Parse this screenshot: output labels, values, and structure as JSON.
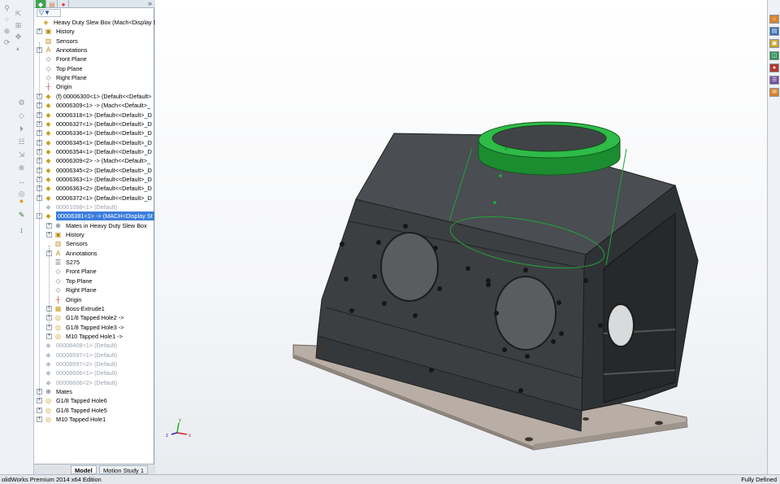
{
  "feature_manager": {
    "collapse_glyph": "»",
    "filter_glyph": "▼",
    "tabs": [
      {
        "icon": "feature-tree-icon"
      },
      {
        "icon": "property-manager-icon"
      },
      {
        "icon": "configuration-manager-icon"
      }
    ],
    "tree": [
      {
        "label": "Heavy Duty Slew Box  (Mach<Display St",
        "icon": "assembly-icon",
        "level": 0,
        "expander": "",
        "suppressed": false
      },
      {
        "label": "History",
        "icon": "history-icon",
        "level": 1,
        "expander": "+",
        "suppressed": false
      },
      {
        "label": "Sensors",
        "icon": "sensors-icon",
        "level": 1,
        "expander": "",
        "suppressed": false
      },
      {
        "label": "Annotations",
        "icon": "annotations-icon",
        "level": 1,
        "expander": "+",
        "suppressed": false
      },
      {
        "label": "Front Plane",
        "icon": "plane-icon",
        "level": 1,
        "expander": "",
        "suppressed": false
      },
      {
        "label": "Top Plane",
        "icon": "plane-icon",
        "level": 1,
        "expander": "",
        "suppressed": false
      },
      {
        "label": "Right Plane",
        "icon": "plane-icon",
        "level": 1,
        "expander": "",
        "suppressed": false
      },
      {
        "label": "Origin",
        "icon": "origin-icon",
        "level": 1,
        "expander": "",
        "suppressed": false
      },
      {
        "label": "(f) 00006300<1> (Default<<Default>",
        "icon": "part-icon",
        "level": 1,
        "expander": "+",
        "suppressed": false
      },
      {
        "label": "00006309<1> -> (Mach<<Default>_",
        "icon": "part-icon",
        "level": 1,
        "expander": "+",
        "suppressed": false
      },
      {
        "label": "00006318<1> (Default<<Default>_D",
        "icon": "part-icon",
        "level": 1,
        "expander": "+",
        "suppressed": false
      },
      {
        "label": "00006327<1> (Default<<Default>_D",
        "icon": "part-icon",
        "level": 1,
        "expander": "+",
        "suppressed": false
      },
      {
        "label": "00006336<1> (Default<<Default>_D",
        "icon": "part-icon",
        "level": 1,
        "expander": "+",
        "suppressed": false
      },
      {
        "label": "00006345<1> (Default<<Default>_D",
        "icon": "part-icon",
        "level": 1,
        "expander": "+",
        "suppressed": false
      },
      {
        "label": "00006354<1> (Default<<Default>_D",
        "icon": "part-icon",
        "level": 1,
        "expander": "+",
        "suppressed": false
      },
      {
        "label": "00006309<2> -> (Mach<<Default>_",
        "icon": "part-icon",
        "level": 1,
        "expander": "+",
        "suppressed": false
      },
      {
        "label": "00006345<2> (Default<<Default>_D",
        "icon": "part-icon",
        "level": 1,
        "expander": "+",
        "suppressed": false
      },
      {
        "label": "00006363<1> (Default<<Default>_D",
        "icon": "part-icon",
        "level": 1,
        "expander": "+",
        "suppressed": false
      },
      {
        "label": "00006363<2> (Default<<Default>_D",
        "icon": "part-icon",
        "level": 1,
        "expander": "+",
        "suppressed": false
      },
      {
        "label": "00006372<1> (Default<<Default>_D",
        "icon": "part-icon",
        "level": 1,
        "expander": "+",
        "suppressed": false
      },
      {
        "label": "00001098<1> (Default)",
        "icon": "part-icon",
        "level": 1,
        "expander": "",
        "suppressed": true
      },
      {
        "label": "00006381<1> -> (MACH<Display St",
        "icon": "part-icon",
        "level": 1,
        "expander": "-",
        "suppressed": false,
        "selected": true
      },
      {
        "label": "Mates in Heavy Duty Slew Box",
        "icon": "mates-icon",
        "level": 2,
        "expander": "+",
        "suppressed": false
      },
      {
        "label": "History",
        "icon": "history-icon",
        "level": 2,
        "expander": "+",
        "suppressed": false
      },
      {
        "label": "Sensors",
        "icon": "sensors-icon",
        "level": 2,
        "expander": "",
        "suppressed": false
      },
      {
        "label": "Annotations",
        "icon": "annotations-icon",
        "level": 2,
        "expander": "+",
        "suppressed": false
      },
      {
        "label": "S275",
        "icon": "material-icon",
        "level": 2,
        "expander": "",
        "suppressed": false
      },
      {
        "label": "Front Plane",
        "icon": "plane-icon",
        "level": 2,
        "expander": "",
        "suppressed": false
      },
      {
        "label": "Top Plane",
        "icon": "plane-icon",
        "level": 2,
        "expander": "",
        "suppressed": false
      },
      {
        "label": "Right Plane",
        "icon": "plane-icon",
        "level": 2,
        "expander": "",
        "suppressed": false
      },
      {
        "label": "Origin",
        "icon": "origin-icon",
        "level": 2,
        "expander": "",
        "suppressed": false
      },
      {
        "label": "Boss-Extrude1",
        "icon": "extrude-icon",
        "level": 2,
        "expander": "+",
        "suppressed": false
      },
      {
        "label": "G1/8 Tapped Hole2 ->",
        "icon": "hole-icon",
        "level": 2,
        "expander": "+",
        "suppressed": false
      },
      {
        "label": "G1/8 Tapped Hole3 ->",
        "icon": "hole-icon",
        "level": 2,
        "expander": "+",
        "suppressed": false
      },
      {
        "label": "M10 Tapped Hole1 ->",
        "icon": "hole-icon",
        "level": 2,
        "expander": "+",
        "suppressed": false
      },
      {
        "label": "00006408<1> (Default)",
        "icon": "part-icon",
        "level": 1,
        "expander": "",
        "suppressed": true
      },
      {
        "label": "00006597<1> (Default)",
        "icon": "part-icon",
        "level": 1,
        "expander": "",
        "suppressed": true
      },
      {
        "label": "00006597<2> (Default)",
        "icon": "part-icon",
        "level": 1,
        "expander": "",
        "suppressed": true
      },
      {
        "label": "00006606<1> (Default)",
        "icon": "part-icon",
        "level": 1,
        "expander": "",
        "suppressed": true
      },
      {
        "label": "00006606<2> (Default)",
        "icon": "part-icon",
        "level": 1,
        "expander": "",
        "suppressed": true
      },
      {
        "label": "Mates",
        "icon": "mates-icon",
        "level": 1,
        "expander": "+",
        "suppressed": false
      },
      {
        "label": "G1/8 Tapped Hole6",
        "icon": "hole-icon",
        "level": 1,
        "expander": "+",
        "suppressed": false
      },
      {
        "label": "G1/8 Tapped Hole5",
        "icon": "hole-icon",
        "level": 1,
        "expander": "+",
        "suppressed": false
      },
      {
        "label": "M10 Tapped Hole1",
        "icon": "hole-icon",
        "level": 1,
        "expander": "+",
        "suppressed": false
      }
    ],
    "bottom_tabs": [
      {
        "label": "Model",
        "active": true
      },
      {
        "label": "Motion Study 1",
        "active": false
      }
    ]
  },
  "left_toolbar": {
    "buttons": [
      "smart-mate-icon",
      "explode-icon",
      "linear-pattern-icon",
      "insert-component-icon",
      "mate-icon",
      "move-component-icon",
      "rotate-component-icon",
      "show-hidden-icon",
      "assembly-features-icon",
      "reference-geometry-icon",
      "new-motion-study-icon",
      "bill-of-materials-icon",
      "exploded-view-icon",
      "interference-icon",
      "clearance-icon",
      "hole-series-icon",
      "appearance-icon",
      "sketch-icon",
      "smart-dimension-icon"
    ]
  },
  "task_pane": {
    "buttons": [
      {
        "icon": "solidworks-resources-icon",
        "color": "#d9822b"
      },
      {
        "icon": "design-library-icon",
        "color": "#3b6db3"
      },
      {
        "icon": "file-explorer-icon",
        "color": "#c9a227"
      },
      {
        "icon": "view-palette-icon",
        "color": "#2f8f4e"
      },
      {
        "icon": "appearances-icon",
        "color": "#b2372f"
      },
      {
        "icon": "custom-properties-icon",
        "color": "#7a4fa0"
      },
      {
        "icon": "forum-icon",
        "color": "#d9822b"
      }
    ]
  },
  "triad": {
    "x_label": "x",
    "y_label": "y",
    "z_label": "z"
  },
  "status_bar": {
    "left": "olidWorks Premium 2014 x64 Edition",
    "right": "Fully Defined"
  },
  "colors": {
    "selection": "#3b7ddd",
    "highlight_green": "#22a33a",
    "body_dark": "#3a3d40",
    "base_plate": "#b6aca3"
  }
}
